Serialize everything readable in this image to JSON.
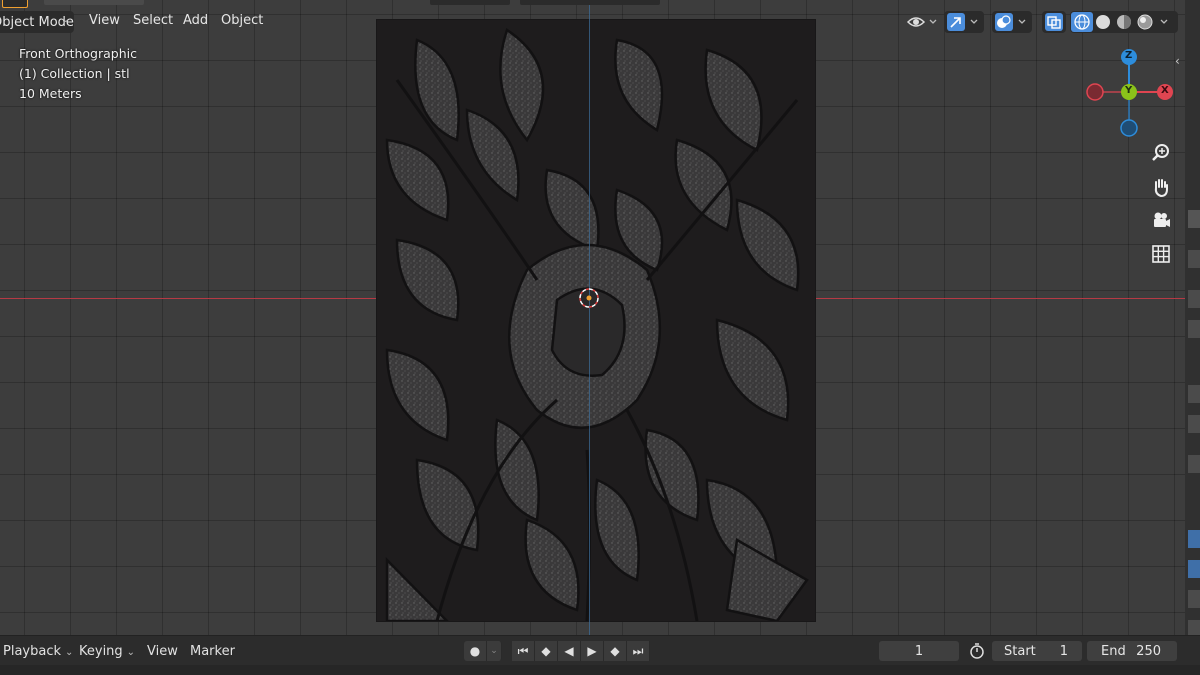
{
  "header": {
    "mode_label": "Object Mode",
    "menu": [
      "View",
      "Select",
      "Add",
      "Object"
    ]
  },
  "overlay": {
    "view_name": "Front Orthographic",
    "collection": "(1) Collection | stl",
    "scale": "10 Meters"
  },
  "gizmo": {
    "z_label": "Z",
    "y_label": "Y",
    "x_label": "X",
    "colors": {
      "x": "#e04551",
      "y": "#8bc21a",
      "z": "#2d8ddc"
    }
  },
  "nav_icons": [
    "zoom-icon",
    "pan-hand-icon",
    "camera-icon",
    "grid-icon"
  ],
  "timeline": {
    "playback_label": "Playback",
    "keying_label": "Keying",
    "view_label": "View",
    "marker_label": "Marker",
    "current_frame": "1",
    "start_label": "Start",
    "start_value": "1",
    "end_label": "End",
    "end_value": "250"
  },
  "colors": {
    "accent_orange": "#f0a030",
    "x_axis": "#b63a45",
    "active_blue": "#4b8ddb"
  }
}
